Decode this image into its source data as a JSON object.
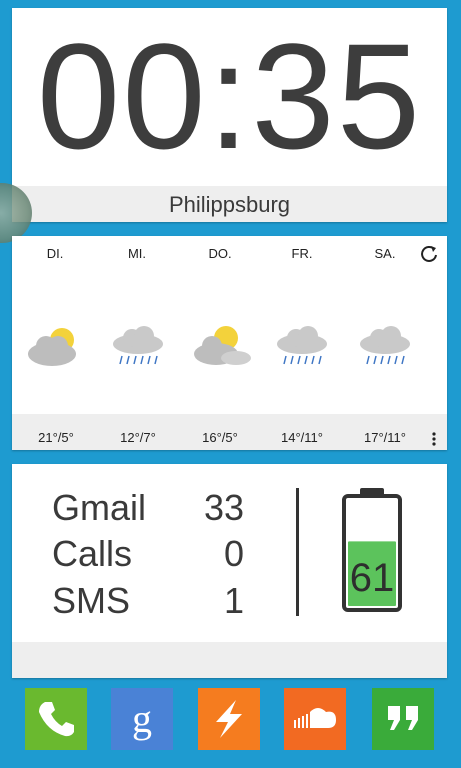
{
  "clock": {
    "time": "00:35",
    "city": "Philippsburg"
  },
  "weather": {
    "days": [
      {
        "label": "DI.",
        "condition": "partly-cloudy-icon",
        "temp": "21°/5°"
      },
      {
        "label": "MI.",
        "condition": "rain-icon",
        "temp": "12°/7°"
      },
      {
        "label": "DO.",
        "condition": "partly-cloudy-icon",
        "temp": "16°/5°"
      },
      {
        "label": "FR.",
        "condition": "rain-icon",
        "temp": "14°/11°"
      },
      {
        "label": "SA.",
        "condition": "rain-icon",
        "temp": "17°/11°"
      }
    ]
  },
  "counts": {
    "items": [
      {
        "label": "Gmail",
        "value": "33"
      },
      {
        "label": "Calls",
        "value": "0"
      },
      {
        "label": "SMS",
        "value": "1"
      }
    ],
    "battery": {
      "level_percent": 61,
      "label": "61"
    }
  },
  "dock": {
    "apps": [
      {
        "icon": "phone-icon",
        "color": "#6ab92f"
      },
      {
        "icon": "google-search-icon",
        "color": "#4a82d6"
      },
      {
        "icon": "lightning-icon",
        "color": "#f57c1f"
      },
      {
        "icon": "soundcloud-icon",
        "color": "#f26a22"
      },
      {
        "icon": "hangouts-icon",
        "color": "#3aab3a"
      }
    ]
  },
  "colors": {
    "background": "#1e9bd0",
    "card": "#ffffff",
    "text": "#3a3a3a",
    "battery_fill": "#5cc35c"
  }
}
